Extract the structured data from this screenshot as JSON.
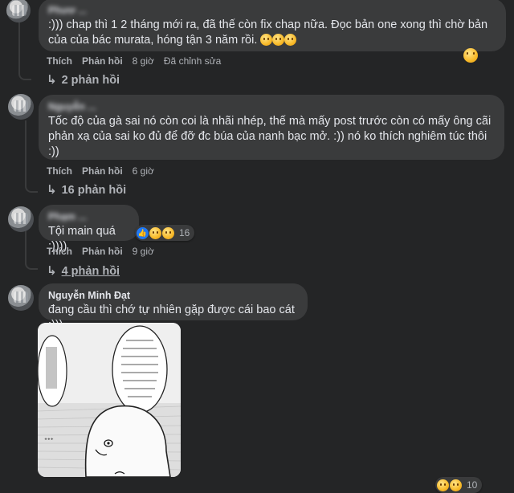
{
  "comments": [
    {
      "author": "Phươ ...",
      "text": ":))) chap thì 1 2 tháng mới ra, đã thế còn fix chap nữa. Đọc bản one xong thì chờ bản của của bác murata, hóng tận 3 năm rồi.",
      "like": "Thích",
      "reply": "Phản hồi",
      "time": "8 giờ",
      "edited": "Đã chỉnh sửa",
      "replies": "2 phản hồi"
    },
    {
      "author": "Nguyễn ...",
      "text": "Tốc độ của gà sai nó còn coi là nhãi nhép, thế mà mấy post trước còn có mấy ông cãi phản xạ của sai ko đủ để đỡ đc búa của nanh bạc mở. :)) nó ko thích nghiêm túc thôi :))",
      "like": "Thích",
      "reply": "Phản hồi",
      "time": "6 giờ",
      "replies": "16 phản hồi"
    },
    {
      "author": "Phạm ...",
      "text": "Tội main quá :))))",
      "reaction_count": "16",
      "like": "Thích",
      "reply": "Phản hồi",
      "time": "9 giờ",
      "replies": "4 phản hồi"
    },
    {
      "author": "Nguyễn Minh Đạt",
      "text": "đang cầu thì chớ tự nhiên gặp được cái bao cát :)))"
    }
  ],
  "bottom_reaction_count": "10",
  "icons": [
    "laugh-emoji",
    "sad-emoji",
    "like-icon",
    "reply-arrow-icon"
  ]
}
